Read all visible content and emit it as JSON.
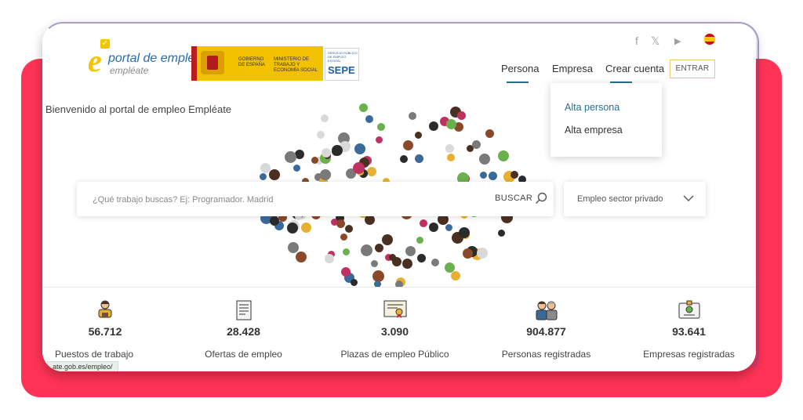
{
  "logo": {
    "letter": "e",
    "title": "portal de empleo",
    "subtitle": "empléate"
  },
  "government": {
    "line1": "GOBIERNO DE ESPAÑA",
    "line2": "MINISTERIO DE TRABAJO Y ECONOMÍA SOCIAL",
    "agency_small": "SERVICIO PÚBLICO DE EMPLEO ESTATAL",
    "agency": "SEPE"
  },
  "social": {
    "facebook": "f",
    "x": "𝕏",
    "youtube": "▶"
  },
  "nav": {
    "items": [
      "Persona",
      "Empresa",
      "Crear cuenta"
    ],
    "login": "ENTRAR"
  },
  "dropdown": {
    "items": [
      "Alta persona",
      "Alta empresa"
    ]
  },
  "welcome": "Bienvenido al portal de empleo Empléate",
  "search": {
    "placeholder": "¿Qué trabajo buscas? Ej: Programador. Madrid",
    "button": "BUSCAR",
    "sector": "Empleo sector privado"
  },
  "stats": [
    {
      "value": "56.712",
      "label": "Puestos de trabajo"
    },
    {
      "value": "28.428",
      "label": "Ofertas de empleo"
    },
    {
      "value": "3.090",
      "label": "Plazas de empleo Público"
    },
    {
      "value": "904.877",
      "label": "Personas registradas"
    },
    {
      "value": "93.641",
      "label": "Empresas registradas"
    }
  ],
  "status_url": "ate.gob.es/empleo/",
  "colors": {
    "accent_red": "#ff3355",
    "brand_yellow": "#f5c400",
    "brand_blue": "#2a6aa8",
    "nav_active": "#2a6f8f"
  }
}
